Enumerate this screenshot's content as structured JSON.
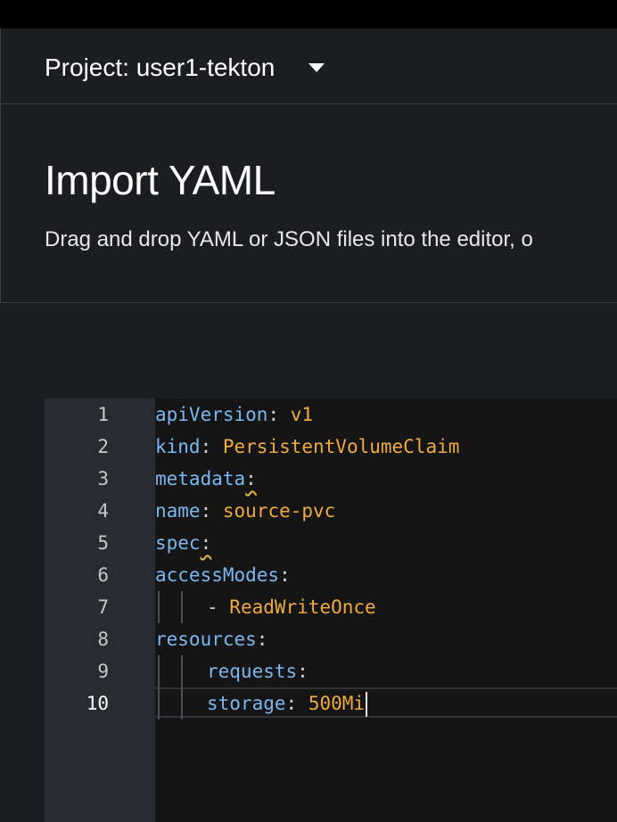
{
  "project": {
    "label": "Project: user1-tekton",
    "dropdown_icon": "caret-down-icon"
  },
  "header": {
    "title": "Import YAML",
    "description": "Drag and drop YAML or JSON files into the editor, o"
  },
  "editor": {
    "active_line": 10,
    "line_numbers": [
      "1",
      "2",
      "3",
      "4",
      "5",
      "6",
      "7",
      "8",
      "9",
      "10"
    ],
    "lines": [
      {
        "key": "apiVersion",
        "sep": ": ",
        "value": "v1"
      },
      {
        "key": "kind",
        "sep": ": ",
        "value": "PersistentVolumeClaim"
      },
      {
        "key": "metadata",
        "sep": ":",
        "value": ""
      },
      {
        "key": "name",
        "sep": ": ",
        "value": "source-pvc"
      },
      {
        "key": "spec",
        "sep": ":",
        "value": ""
      },
      {
        "key": "accessModes",
        "sep": ":",
        "value": ""
      },
      {
        "key": "- ",
        "sep": "",
        "value": "ReadWriteOnce"
      },
      {
        "key": "resources",
        "sep": ":",
        "value": ""
      },
      {
        "key": "requests",
        "sep": ":",
        "value": ""
      },
      {
        "key": "storage",
        "sep": ": ",
        "value": "500Mi"
      }
    ]
  },
  "colors": {
    "key": "#79b8f0",
    "value": "#f0ab3c",
    "background": "#1b1d21",
    "editor_background": "#151515",
    "gutter_background": "#282b2f"
  }
}
